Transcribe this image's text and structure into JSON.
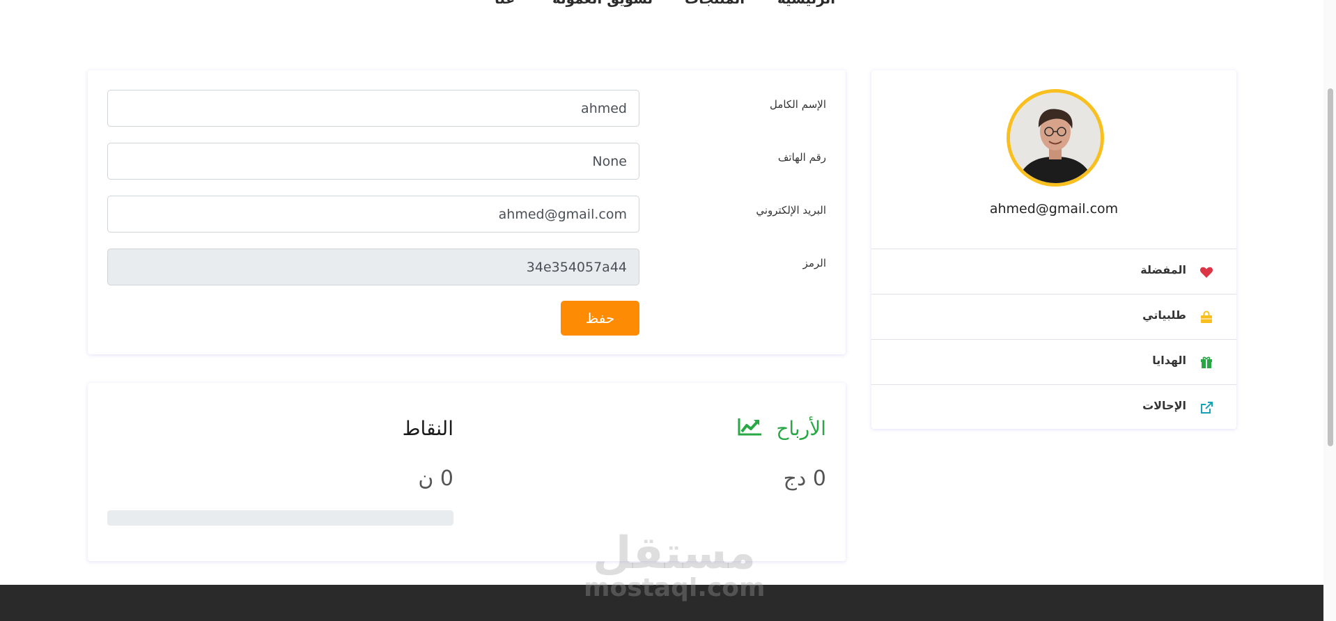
{
  "nav": {
    "items": [
      "الرئيسية",
      "المنتجات",
      "تسويق العمولة",
      "عنا"
    ]
  },
  "form": {
    "full_name_label": "الإسم الكامل",
    "full_name_value": "ahmed",
    "phone_label": "رقم الهاتف",
    "phone_value": "None",
    "email_label": "البريد الإلكتروني",
    "email_value": "ahmed@gmail.com",
    "code_label": "الرمز",
    "code_value": "34e354057a44",
    "save_label": "حفظ"
  },
  "stats": {
    "earnings_title": "الأرباح",
    "earnings_value": "0 دج",
    "points_title": "النقاط",
    "points_value": "0 ن",
    "points_progress": 0
  },
  "profile": {
    "email": "ahmed@gmail.com",
    "menu": [
      {
        "label": "المفضلة",
        "icon": "heart-icon",
        "color": "#dc3545"
      },
      {
        "label": "طلبياتي",
        "icon": "shopping-bag-icon",
        "color": "#f8bf1e"
      },
      {
        "label": "الهدايا",
        "icon": "gift-icon",
        "color": "#28a745"
      },
      {
        "label": "الإحالات",
        "icon": "external-link-icon",
        "color": "#17a2b8"
      }
    ]
  },
  "watermark": {
    "arabic": "مستقل",
    "latin": "mostaql.com"
  },
  "colors": {
    "accent": "#fd8c04",
    "earnings": "#28a745",
    "avatar_ring": "#f8bf1e",
    "footer": "#2a2a2a"
  }
}
